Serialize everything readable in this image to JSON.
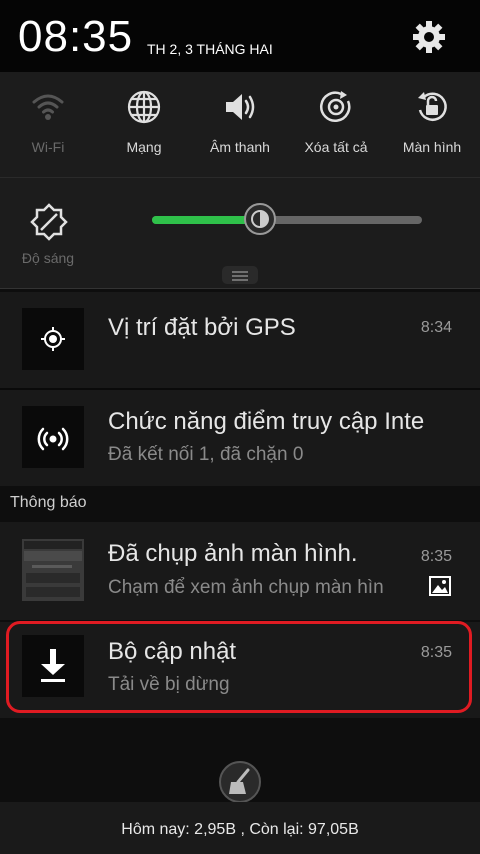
{
  "status_bar": {
    "time": "08:35",
    "date": "TH 2, 3 THÁNG HAI"
  },
  "quick_settings": [
    {
      "label": "Wi-Fi",
      "icon": "wifi-icon",
      "enabled": false
    },
    {
      "label": "Mạng",
      "icon": "globe-icon",
      "enabled": true
    },
    {
      "label": "Âm thanh",
      "icon": "speaker-icon",
      "enabled": true
    },
    {
      "label": "Xóa tất cả",
      "icon": "clear-all-icon",
      "enabled": true
    },
    {
      "label": "Màn hình",
      "icon": "screen-rotation-lock-icon",
      "enabled": true
    }
  ],
  "brightness": {
    "label": "Độ sáng",
    "level": 0.4,
    "fill_color": "#2fc14a"
  },
  "ongoing": [
    {
      "title": "Vị trí đặt bởi GPS",
      "time": "8:34",
      "icon": "gps-icon"
    },
    {
      "title": "Chức năng điểm truy cập Inte",
      "subtitle": "Đã kết nối 1, đã chặn 0",
      "icon": "hotspot-icon"
    }
  ],
  "section": {
    "label": "Thông báo"
  },
  "notifications": [
    {
      "title": "Đã chụp ảnh màn hình.",
      "subtitle": "Chạm để xem ảnh chụp màn hìn",
      "time": "8:35",
      "icon": "screenshot-thumbnail",
      "badge_icon": "image-icon"
    },
    {
      "title": "Bộ cập nhật",
      "subtitle": "Tải về bị dừng",
      "time": "8:35",
      "icon": "download-icon",
      "highlight_color": "#e01b22"
    }
  ],
  "footer": {
    "data_usage": "Hôm nay: 2,95B , Còn lại: 97,05B"
  }
}
